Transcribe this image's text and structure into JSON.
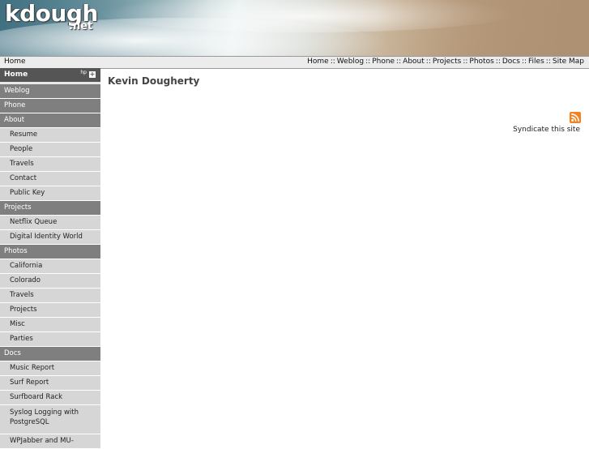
{
  "site": {
    "logo": "kdough",
    "logo_sub": ".net"
  },
  "topbar": {
    "breadcrumb": "Home",
    "links": [
      "Home",
      "Weblog",
      "Phone",
      "About",
      "Projects",
      "Photos",
      "Docs",
      "Files",
      "Site Map"
    ],
    "separator": "::"
  },
  "sidebar": {
    "header": {
      "label": "Home",
      "mini": "hp",
      "toggle": "+"
    },
    "items": [
      {
        "label": "Weblog",
        "type": "section"
      },
      {
        "label": "Phone",
        "type": "section"
      },
      {
        "label": "About",
        "type": "section"
      },
      {
        "label": "Resume",
        "type": "sub"
      },
      {
        "label": "People",
        "type": "sub"
      },
      {
        "label": "Travels",
        "type": "sub"
      },
      {
        "label": "Contact",
        "type": "sub"
      },
      {
        "label": "Public Key",
        "type": "sub"
      },
      {
        "label": "Projects",
        "type": "section"
      },
      {
        "label": "Netflix Queue",
        "type": "sub"
      },
      {
        "label": "Digital Identity World",
        "type": "sub"
      },
      {
        "label": "Photos",
        "type": "section"
      },
      {
        "label": "California",
        "type": "sub"
      },
      {
        "label": "Colorado",
        "type": "sub"
      },
      {
        "label": "Travels",
        "type": "sub"
      },
      {
        "label": "Projects",
        "type": "sub"
      },
      {
        "label": "Misc",
        "type": "sub"
      },
      {
        "label": "Parties",
        "type": "sub"
      },
      {
        "label": "Docs",
        "type": "section"
      },
      {
        "label": "Music Report",
        "type": "sub"
      },
      {
        "label": "Surf Report",
        "type": "sub"
      },
      {
        "label": "Surfboard Rack",
        "type": "sub"
      },
      {
        "label": "Syslog Logging with PostgreSQL",
        "type": "sub",
        "tall": true
      },
      {
        "label": "WPJabber and MU-",
        "type": "sub"
      }
    ]
  },
  "main": {
    "title": "Kevin Dougherty",
    "syndicate": "Syndicate this site",
    "rss_icon": "rss-feed-icon"
  },
  "colors": {
    "sidebar_header": "#555555",
    "sidebar_section": "#7f7f7f",
    "sidebar_sub": "#d6d6d6",
    "rss": "#f58220"
  }
}
